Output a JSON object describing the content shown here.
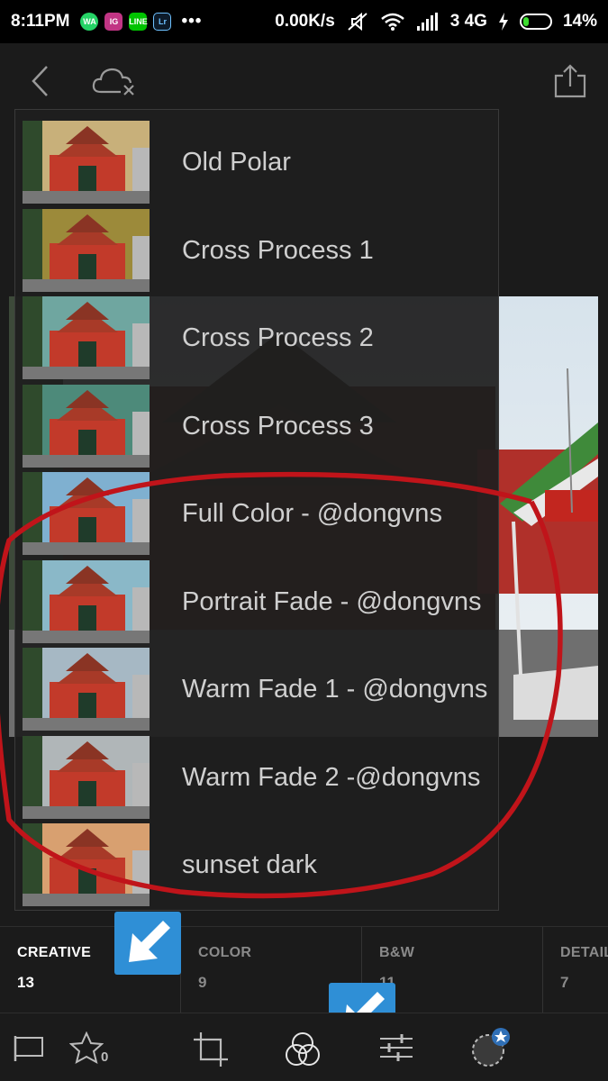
{
  "status_bar": {
    "time": "8:11PM",
    "apps": [
      "WA",
      "IG",
      "LINE",
      "Lr"
    ],
    "more": "•••",
    "network_speed": "0.00K/s",
    "network_type": "3 4G",
    "battery": "14%"
  },
  "top_bar": {
    "back_icon": "chevron-left-icon",
    "cloud_icon": "cloud-off-icon",
    "share_icon": "share-icon"
  },
  "presets": [
    {
      "label": "Old Polar",
      "tint": "#c8b07a"
    },
    {
      "label": "Cross Process 1",
      "tint": "#9c8a3a"
    },
    {
      "label": "Cross Process 2",
      "tint": "#6fa6a0"
    },
    {
      "label": "Cross Process 3",
      "tint": "#4d8a7a"
    },
    {
      "label": "Full Color - @dongvns",
      "tint": "#7fb0d0"
    },
    {
      "label": "Portrait Fade - @dongvns",
      "tint": "#8ab8c8"
    },
    {
      "label": "Warm Fade 1 - @dongvns",
      "tint": "#a6b8c4"
    },
    {
      "label": "Warm Fade 2 -@dongvns",
      "tint": "#b0b6b8"
    },
    {
      "label": "sunset dark",
      "tint": "#d8a070"
    }
  ],
  "categories": [
    {
      "name": "CREATIVE",
      "count": "13",
      "active": true
    },
    {
      "name": "COLOR",
      "count": "9",
      "active": false
    },
    {
      "name": "B&W",
      "count": "11",
      "active": false
    },
    {
      "name": "DETAIL",
      "count": "7",
      "active": false
    }
  ],
  "toolbar": {
    "flag_icon": "flag-icon",
    "star_icon": "star-icon",
    "star_count": "0",
    "crop_icon": "crop-icon",
    "presets_icon": "presets-icon",
    "adjust_icon": "sliders-icon",
    "selective_icon": "selective-icon"
  },
  "colors": {
    "background": "#1b1b1b",
    "annotation_red": "#c0141a",
    "arrow_blue": "#2f8fd6"
  }
}
